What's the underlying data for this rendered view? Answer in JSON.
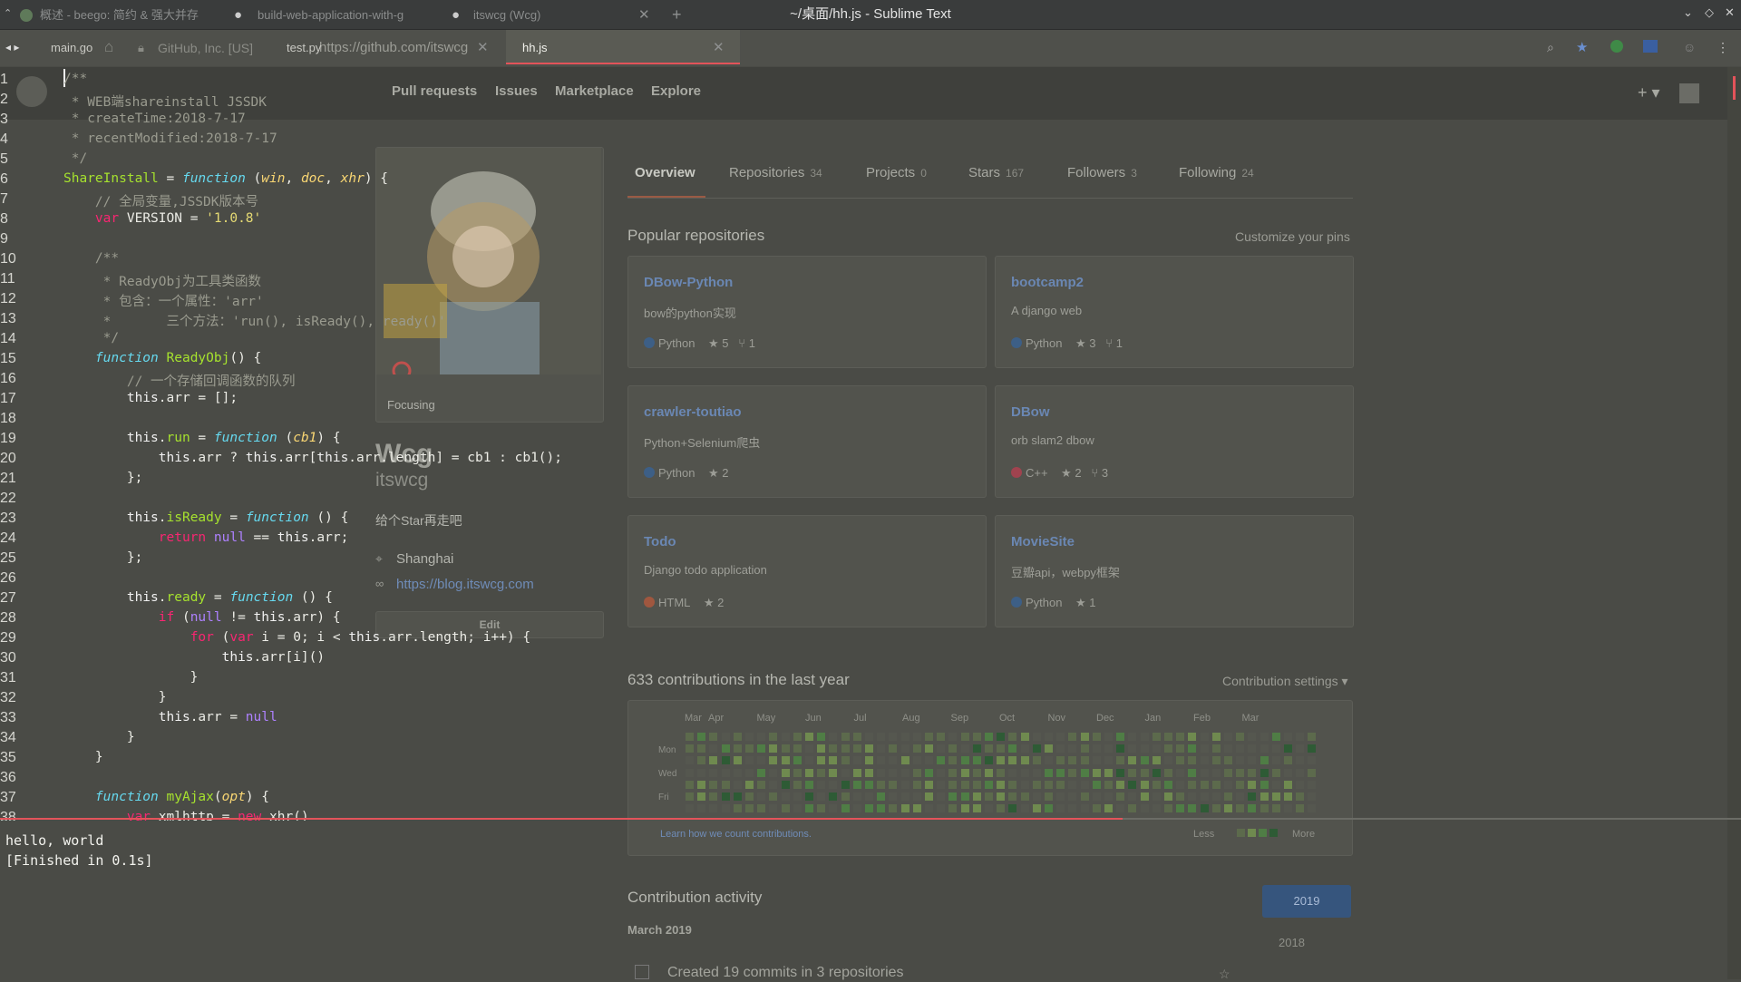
{
  "window": {
    "title": "~/桌面/hh.js - Sublime Text"
  },
  "browser_tabs": [
    {
      "label": "概述 - beego: 简约 & 强大并存"
    },
    {
      "label": "build-web-application-with-g"
    },
    {
      "label": "itswcg (Wcg)"
    }
  ],
  "browser_url": {
    "lock_text": "GitHub, Inc. [US]",
    "url": "https://github.com/itswcg"
  },
  "editor_tabs": [
    {
      "label": "main.go"
    },
    {
      "label": "test.py"
    },
    {
      "label": "hh.js"
    }
  ],
  "github": {
    "nav": [
      "Pull requests",
      "Issues",
      "Marketplace",
      "Explore"
    ],
    "profile": {
      "status": "Focusing",
      "name": "Wcg",
      "username": "itswcg",
      "bio": "给个Star再走吧",
      "location": "Shanghai",
      "website": "https://blog.itswcg.com",
      "edit_label": "Edit"
    },
    "tabs": [
      {
        "label": "Overview",
        "count": ""
      },
      {
        "label": "Repositories",
        "count": "34"
      },
      {
        "label": "Projects",
        "count": "0"
      },
      {
        "label": "Stars",
        "count": "167"
      },
      {
        "label": "Followers",
        "count": "3"
      },
      {
        "label": "Following",
        "count": "24"
      }
    ],
    "popular_title": "Popular repositories",
    "customize_label": "Customize your pins",
    "repos": [
      {
        "name": "DBow-Python",
        "desc": "bow的python实现",
        "lang": "Python",
        "color": "#3572A5",
        "stars": "5",
        "forks": "1"
      },
      {
        "name": "bootcamp2",
        "desc": "A django web",
        "lang": "Python",
        "color": "#3572A5",
        "stars": "3",
        "forks": "1"
      },
      {
        "name": "crawler-toutiao",
        "desc": "Python+Selenium爬虫",
        "lang": "Python",
        "color": "#3572A5",
        "stars": "2",
        "forks": ""
      },
      {
        "name": "DBow",
        "desc": "orb slam2 dbow",
        "lang": "C++",
        "color": "#f34b7d",
        "stars": "2",
        "forks": "3"
      },
      {
        "name": "Todo",
        "desc": "Django todo application",
        "lang": "HTML",
        "color": "#e34c26",
        "stars": "2",
        "forks": ""
      },
      {
        "name": "MovieSite",
        "desc": "豆瓣api，webpy框架",
        "lang": "Python",
        "color": "#3572A5",
        "stars": "1",
        "forks": ""
      }
    ],
    "contrib_title": "633 contributions in the last year",
    "contrib_settings": "Contribution settings ▾",
    "months": [
      "Mar",
      "Apr",
      "May",
      "Jun",
      "Jul",
      "Aug",
      "Sep",
      "Oct",
      "Nov",
      "Dec",
      "Jan",
      "Feb",
      "Mar"
    ],
    "days": [
      "Mon",
      "Wed",
      "Fri"
    ],
    "learn_link": "Learn how we count contributions.",
    "less": "Less",
    "more": "More",
    "activity_title": "Contribution activity",
    "activity_month": "March 2019",
    "activity_text": "Created 19 commits in 3 repositories",
    "years": [
      "2019",
      "2018"
    ]
  },
  "code_lines": [
    "/**",
    " * WEB端shareinstall JSSDK",
    " * createTime:2018-7-17",
    " * recentModified:2018-7-17",
    " */",
    "ShareInstall = function (win, doc, xhr) {",
    "    // 全局变量,JSSDK版本号",
    "    var VERSION = '1.0.8'",
    "",
    "    /**",
    "     * ReadyObj为工具类函数",
    "     * 包含：一个属性：'arr'",
    "     *       三个方法：'run(), isReady(), ready()'",
    "     */",
    "    function ReadyObj() {",
    "        // 一个存储回调函数的队列",
    "        this.arr = [];",
    "",
    "        this.run = function (cb1) {",
    "            this.arr ? this.arr[this.arr.length] = cb1 : cb1();",
    "        };",
    "",
    "        this.isReady = function () {",
    "            return null == this.arr;",
    "        };",
    "",
    "        this.ready = function () {",
    "            if (null != this.arr) {",
    "                for (var i = 0; i < this.arr.length; i++) {",
    "                    this.arr[i]()",
    "                }",
    "            }",
    "            this.arr = null",
    "        }",
    "    }",
    "",
    "    function myAjax(opt) {",
    "        var xmlhttp = new xhr()"
  ],
  "console": [
    "hello, world",
    "[Finished in 0.1s]"
  ]
}
